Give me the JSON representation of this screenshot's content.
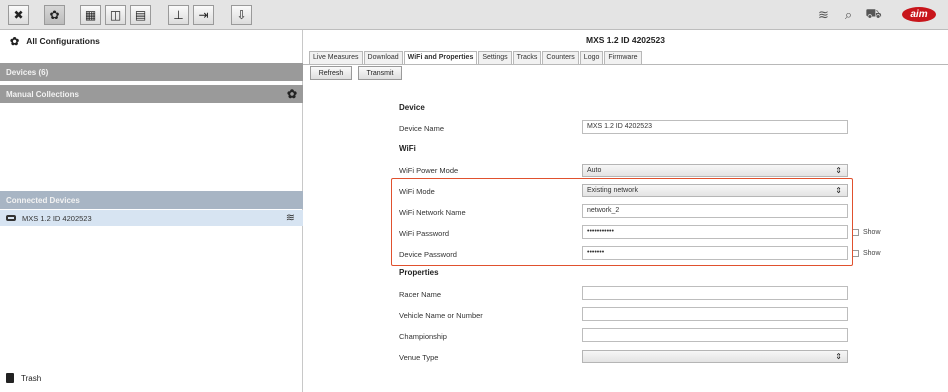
{
  "toolbar": {
    "left_icons": [
      "wrench-icon",
      "gear-icon",
      "chart-icon",
      "map-icon",
      "sliders-icon",
      "import-icon",
      "export-icon",
      "download-icon"
    ],
    "right_icons": [
      "wifi-icon",
      "search-icon",
      "car-icon"
    ],
    "logo_text": "aim"
  },
  "sidebar": {
    "all_configurations": "All Configurations",
    "devices_label": "Devices (6)",
    "manual_collections_label": "Manual Collections",
    "connected_devices_label": "Connected Devices",
    "connected_device_name": "MXS 1.2 ID 4202523",
    "trash_label": "Trash"
  },
  "main": {
    "device_title": "MXS 1.2 ID 4202523",
    "tabs": [
      {
        "label": "Live Measures"
      },
      {
        "label": "Download"
      },
      {
        "label": "WiFi and Properties"
      },
      {
        "label": "Settings"
      },
      {
        "label": "Tracks"
      },
      {
        "label": "Counters"
      },
      {
        "label": "Logo"
      },
      {
        "label": "Firmware"
      }
    ],
    "active_tab": "WiFi and Properties",
    "refresh_label": "Refresh",
    "transmit_label": "Transmit"
  },
  "form": {
    "device_section": "Device",
    "device_name_label": "Device Name",
    "device_name_value": "MXS 1.2 ID 4202523",
    "wifi_section": "WiFi",
    "wifi_power_mode_label": "WiFi Power Mode",
    "wifi_power_mode_value": "Auto",
    "wifi_mode_label": "WiFi Mode",
    "wifi_mode_value": "Existing network",
    "wifi_network_name_label": "WiFi Network Name",
    "wifi_network_name_value": "network_2",
    "wifi_password_label": "WiFi Password",
    "wifi_password_value": "•••••••••••",
    "device_password_label": "Device Password",
    "device_password_value": "•••••••",
    "show_label": "Show",
    "properties_section": "Properties",
    "racer_name_label": "Racer Name",
    "racer_name_value": "",
    "vehicle_label": "Vehicle Name or Number",
    "vehicle_value": "",
    "championship_label": "Championship",
    "championship_value": "",
    "venue_type_label": "Venue Type",
    "venue_type_value": ""
  }
}
